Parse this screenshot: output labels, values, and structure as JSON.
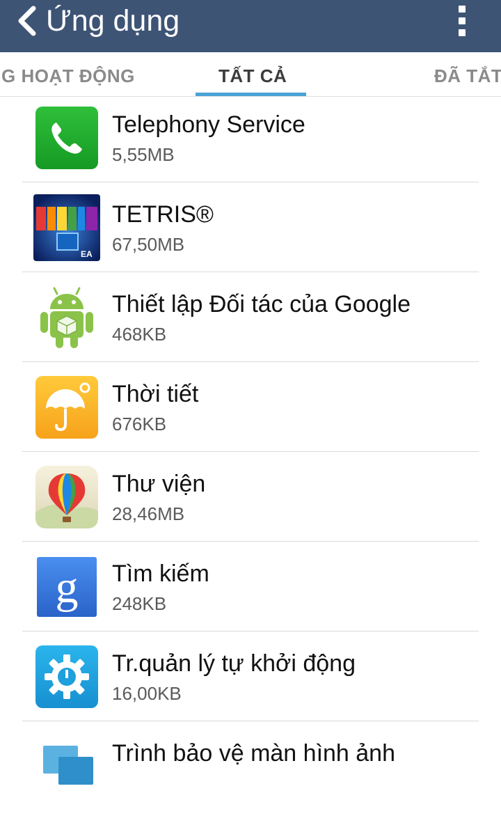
{
  "header": {
    "title": "Ứng dụng"
  },
  "tabs": [
    {
      "label": "G HOẠT ĐỘNG",
      "active": false
    },
    {
      "label": "TẤT CẢ",
      "active": true
    },
    {
      "label": "ĐÃ TẮT",
      "active": false
    }
  ],
  "apps": [
    {
      "name": "Telephony Service",
      "size": "5,55MB",
      "icon": "phone-icon"
    },
    {
      "name": "TETRIS®",
      "size": "67,50MB",
      "icon": "tetris-icon"
    },
    {
      "name": "Thiết lập Đối tác của Google",
      "size": "468KB",
      "icon": "android-icon"
    },
    {
      "name": "Thời tiết",
      "size": "676KB",
      "icon": "weather-icon"
    },
    {
      "name": "Thư viện",
      "size": "28,46MB",
      "icon": "gallery-icon"
    },
    {
      "name": "Tìm kiếm",
      "size": "248KB",
      "icon": "google-search-icon"
    },
    {
      "name": "Tr.quản lý tự khởi động",
      "size": "16,00KB",
      "icon": "autostart-icon"
    },
    {
      "name": "Trình bảo vệ màn hình ảnh",
      "size": "",
      "icon": "screensaver-icon"
    }
  ],
  "colors": {
    "actionbar": "#3d5475",
    "tab_accent": "#4aa3d6"
  }
}
